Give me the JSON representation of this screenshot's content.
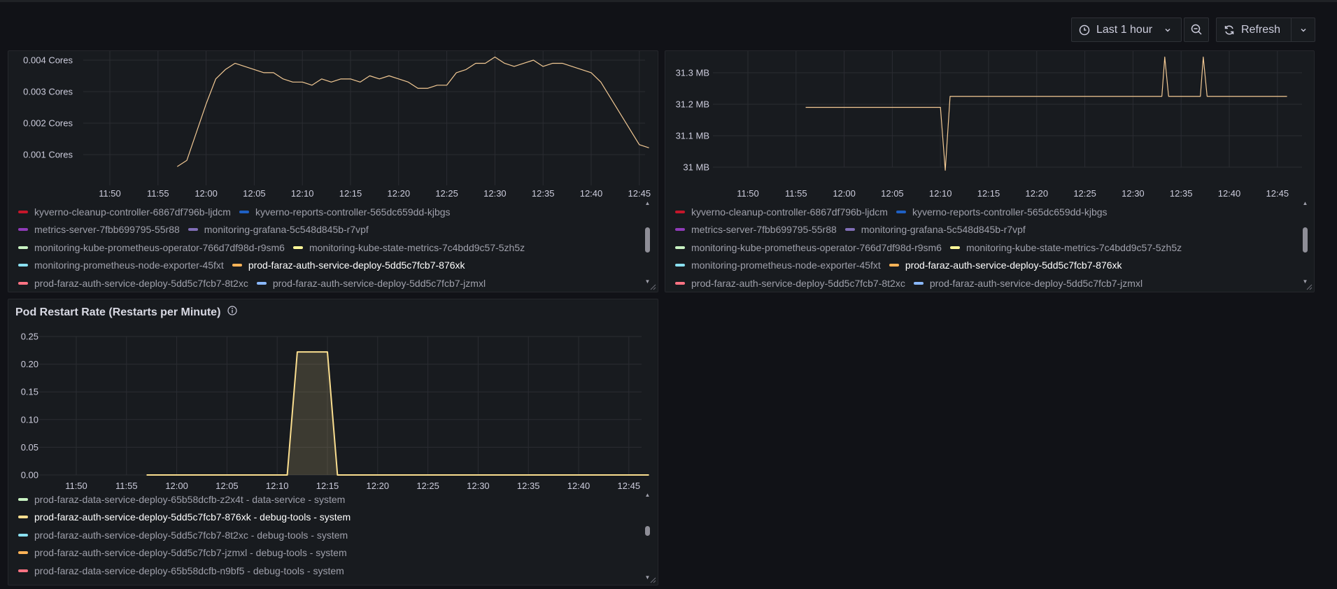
{
  "toolbar": {
    "time_range_label": "Last 1 hour",
    "refresh_label": "Refresh",
    "clock_icon": "clock-icon",
    "zoom_out_icon": "zoom-out-icon",
    "refresh_icon": "refresh-icon",
    "chevron_icon": "chevron-down-icon"
  },
  "colors": {
    "background": "#111217",
    "panel": "#181b1f",
    "series_highlight": "#f2c994",
    "restart_series": "#fade8f"
  },
  "panels": {
    "cpu": {
      "y_ticks": [
        "0.004 Cores",
        "0.003 Cores",
        "0.002 Cores",
        "0.001 Cores"
      ],
      "x_ticks": [
        "11:50",
        "11:55",
        "12:00",
        "12:05",
        "12:10",
        "12:15",
        "12:20",
        "12:25",
        "12:30",
        "12:35",
        "12:40",
        "12:45"
      ],
      "legend": [
        [
          {
            "label": "kyverno-cleanup-controller-6867df796b-ljdcm",
            "color": "#c4162a"
          },
          {
            "label": "kyverno-reports-controller-565dc659dd-kjbgs",
            "color": "#1f60c4"
          }
        ],
        [
          {
            "label": "metrics-server-7fbb699795-55r88",
            "color": "#8f3bb8"
          },
          {
            "label": "monitoring-grafana-5c548d845b-r7vpf",
            "color": "#806eb7"
          }
        ],
        [
          {
            "label": "monitoring-kube-prometheus-operator-766d7df98d-r9sm6",
            "color": "#c8f2c2"
          },
          {
            "label": "monitoring-kube-state-metrics-7c4bdd9c57-5zh5z",
            "color": "#fff899"
          }
        ],
        [
          {
            "label": "monitoring-prometheus-node-exporter-45fxt",
            "color": "#8ae0f0"
          },
          {
            "label": "prod-faraz-auth-service-deploy-5dd5c7fcb7-876xk",
            "color": "#ffb357",
            "highlight": true
          }
        ],
        [
          {
            "label": "prod-faraz-auth-service-deploy-5dd5c7fcb7-8t2xc",
            "color": "#ff7383"
          },
          {
            "label": "prod-faraz-auth-service-deploy-5dd5c7fcb7-jzmxl",
            "color": "#8ab8ff"
          }
        ]
      ]
    },
    "memory": {
      "y_ticks": [
        "31.3 MB",
        "31.2 MB",
        "31.1 MB",
        "31 MB"
      ],
      "x_ticks": [
        "11:50",
        "11:55",
        "12:00",
        "12:05",
        "12:10",
        "12:15",
        "12:20",
        "12:25",
        "12:30",
        "12:35",
        "12:40",
        "12:45"
      ],
      "legend": [
        [
          {
            "label": "kyverno-cleanup-controller-6867df796b-ljdcm",
            "color": "#c4162a"
          },
          {
            "label": "kyverno-reports-controller-565dc659dd-kjbgs",
            "color": "#1f60c4"
          }
        ],
        [
          {
            "label": "metrics-server-7fbb699795-55r88",
            "color": "#8f3bb8"
          },
          {
            "label": "monitoring-grafana-5c548d845b-r7vpf",
            "color": "#806eb7"
          }
        ],
        [
          {
            "label": "monitoring-kube-prometheus-operator-766d7df98d-r9sm6",
            "color": "#c8f2c2"
          },
          {
            "label": "monitoring-kube-state-metrics-7c4bdd9c57-5zh5z",
            "color": "#fff899"
          }
        ],
        [
          {
            "label": "monitoring-prometheus-node-exporter-45fxt",
            "color": "#8ae0f0"
          },
          {
            "label": "prod-faraz-auth-service-deploy-5dd5c7fcb7-876xk",
            "color": "#ffb357",
            "highlight": true
          }
        ],
        [
          {
            "label": "prod-faraz-auth-service-deploy-5dd5c7fcb7-8t2xc",
            "color": "#ff7383"
          },
          {
            "label": "prod-faraz-auth-service-deploy-5dd5c7fcb7-jzmxl",
            "color": "#8ab8ff"
          }
        ]
      ]
    },
    "restarts": {
      "title": "Pod Restart Rate (Restarts per Minute)",
      "info_icon": "info-icon",
      "y_ticks": [
        "0.25",
        "0.20",
        "0.15",
        "0.10",
        "0.05",
        "0.00"
      ],
      "x_ticks": [
        "11:50",
        "11:55",
        "12:00",
        "12:05",
        "12:10",
        "12:15",
        "12:20",
        "12:25",
        "12:30",
        "12:35",
        "12:40",
        "12:45"
      ],
      "legend": [
        [
          {
            "label": "prod-faraz-data-service-deploy-65b58dcfb-z2x4t - data-service - system",
            "color": "#c8f2c2"
          }
        ],
        [
          {
            "label": "prod-faraz-auth-service-deploy-5dd5c7fcb7-876xk - debug-tools - system",
            "color": "#fade8f",
            "highlight": true
          }
        ],
        [
          {
            "label": "prod-faraz-auth-service-deploy-5dd5c7fcb7-8t2xc - debug-tools - system",
            "color": "#8ae0f0"
          }
        ],
        [
          {
            "label": "prod-faraz-auth-service-deploy-5dd5c7fcb7-jzmxl - debug-tools - system",
            "color": "#ffb357"
          }
        ],
        [
          {
            "label": "prod-faraz-data-service-deploy-65b58dcfb-n9bf5 - debug-tools - system",
            "color": "#ff7383"
          }
        ]
      ]
    }
  },
  "chart_data": [
    {
      "type": "line",
      "title": "",
      "ylabel": "Cores",
      "ylim": [
        0.0,
        0.0042
      ],
      "series": [
        {
          "name": "prod-faraz-auth-service-deploy-5dd5c7fcb7-876xk",
          "x": [
            "11:57",
            "11:58",
            "11:59",
            "12:00",
            "12:01",
            "12:02",
            "12:03",
            "12:04",
            "12:05",
            "12:06",
            "12:07",
            "12:08",
            "12:09",
            "12:10",
            "12:11",
            "12:12",
            "12:13",
            "12:14",
            "12:15",
            "12:16",
            "12:17",
            "12:18",
            "12:19",
            "12:20",
            "12:21",
            "12:22",
            "12:23",
            "12:24",
            "12:25",
            "12:26",
            "12:27",
            "12:28",
            "12:29",
            "12:30",
            "12:31",
            "12:32",
            "12:33",
            "12:34",
            "12:35",
            "12:36",
            "12:37",
            "12:38",
            "12:39",
            "12:40",
            "12:41",
            "12:42",
            "12:43",
            "12:44",
            "12:45",
            "12:46"
          ],
          "values": [
            0.0006,
            0.0008,
            0.0017,
            0.0026,
            0.0034,
            0.0037,
            0.0039,
            0.0038,
            0.0037,
            0.0036,
            0.0036,
            0.0034,
            0.0033,
            0.0033,
            0.0032,
            0.0034,
            0.0033,
            0.0034,
            0.0034,
            0.0033,
            0.0035,
            0.0034,
            0.0035,
            0.0034,
            0.0033,
            0.0031,
            0.0031,
            0.0032,
            0.0032,
            0.0036,
            0.0037,
            0.0039,
            0.0039,
            0.0041,
            0.0039,
            0.0038,
            0.0039,
            0.004,
            0.0038,
            0.0039,
            0.0039,
            0.0038,
            0.0037,
            0.0036,
            0.0033,
            0.0028,
            0.0023,
            0.0018,
            0.0013,
            0.0012
          ]
        }
      ]
    },
    {
      "type": "line",
      "title": "",
      "ylabel": "MB",
      "ylim": [
        30.97,
        31.36
      ],
      "series": [
        {
          "name": "prod-faraz-auth-service-deploy-5dd5c7fcb7-876xk",
          "x": [
            "11:56",
            "12:10",
            "12:10.5",
            "12:11",
            "12:33",
            "12:33.3",
            "12:33.7",
            "12:37",
            "12:37.3",
            "12:37.7",
            "12:46"
          ],
          "values": [
            31.19,
            31.19,
            30.99,
            31.225,
            31.225,
            31.35,
            31.225,
            31.225,
            31.35,
            31.225,
            31.225
          ]
        }
      ]
    },
    {
      "type": "area",
      "title": "Pod Restart Rate (Restarts per Minute)",
      "ylim": [
        0,
        0.25
      ],
      "series": [
        {
          "name": "prod-faraz-auth-service-deploy-5dd5c7fcb7-876xk - debug-tools - system",
          "x": [
            "11:57",
            "12:11",
            "12:12",
            "12:15",
            "12:16",
            "12:47"
          ],
          "values": [
            0,
            0,
            0.222,
            0.222,
            0,
            0
          ]
        }
      ]
    }
  ]
}
